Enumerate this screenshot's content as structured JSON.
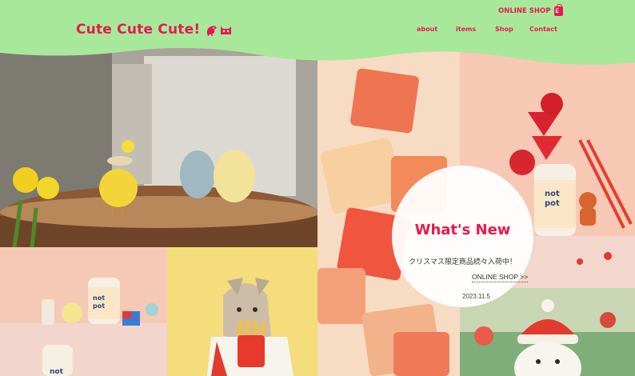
{
  "header": {
    "logo": "Cute Cute Cute!",
    "online_shop": "ONLINE SHOP",
    "nav": [
      "about",
      "items",
      "Shop",
      "Contact"
    ]
  },
  "news": {
    "title": "What's New",
    "item": "クリスマス限定商品続々入荷中！",
    "link": "ONLINE SHOP >>",
    "date": "2023.11.5"
  },
  "product_label": "not pot",
  "colors": {
    "accent": "#e8194f",
    "header_green": "#a8e89a",
    "tile_peach": "#f7c9b5",
    "tile_yellow": "#f5e08a"
  },
  "icons": [
    "bird-logo-icon",
    "cat-logo-icon",
    "shopping-bag-icon"
  ]
}
